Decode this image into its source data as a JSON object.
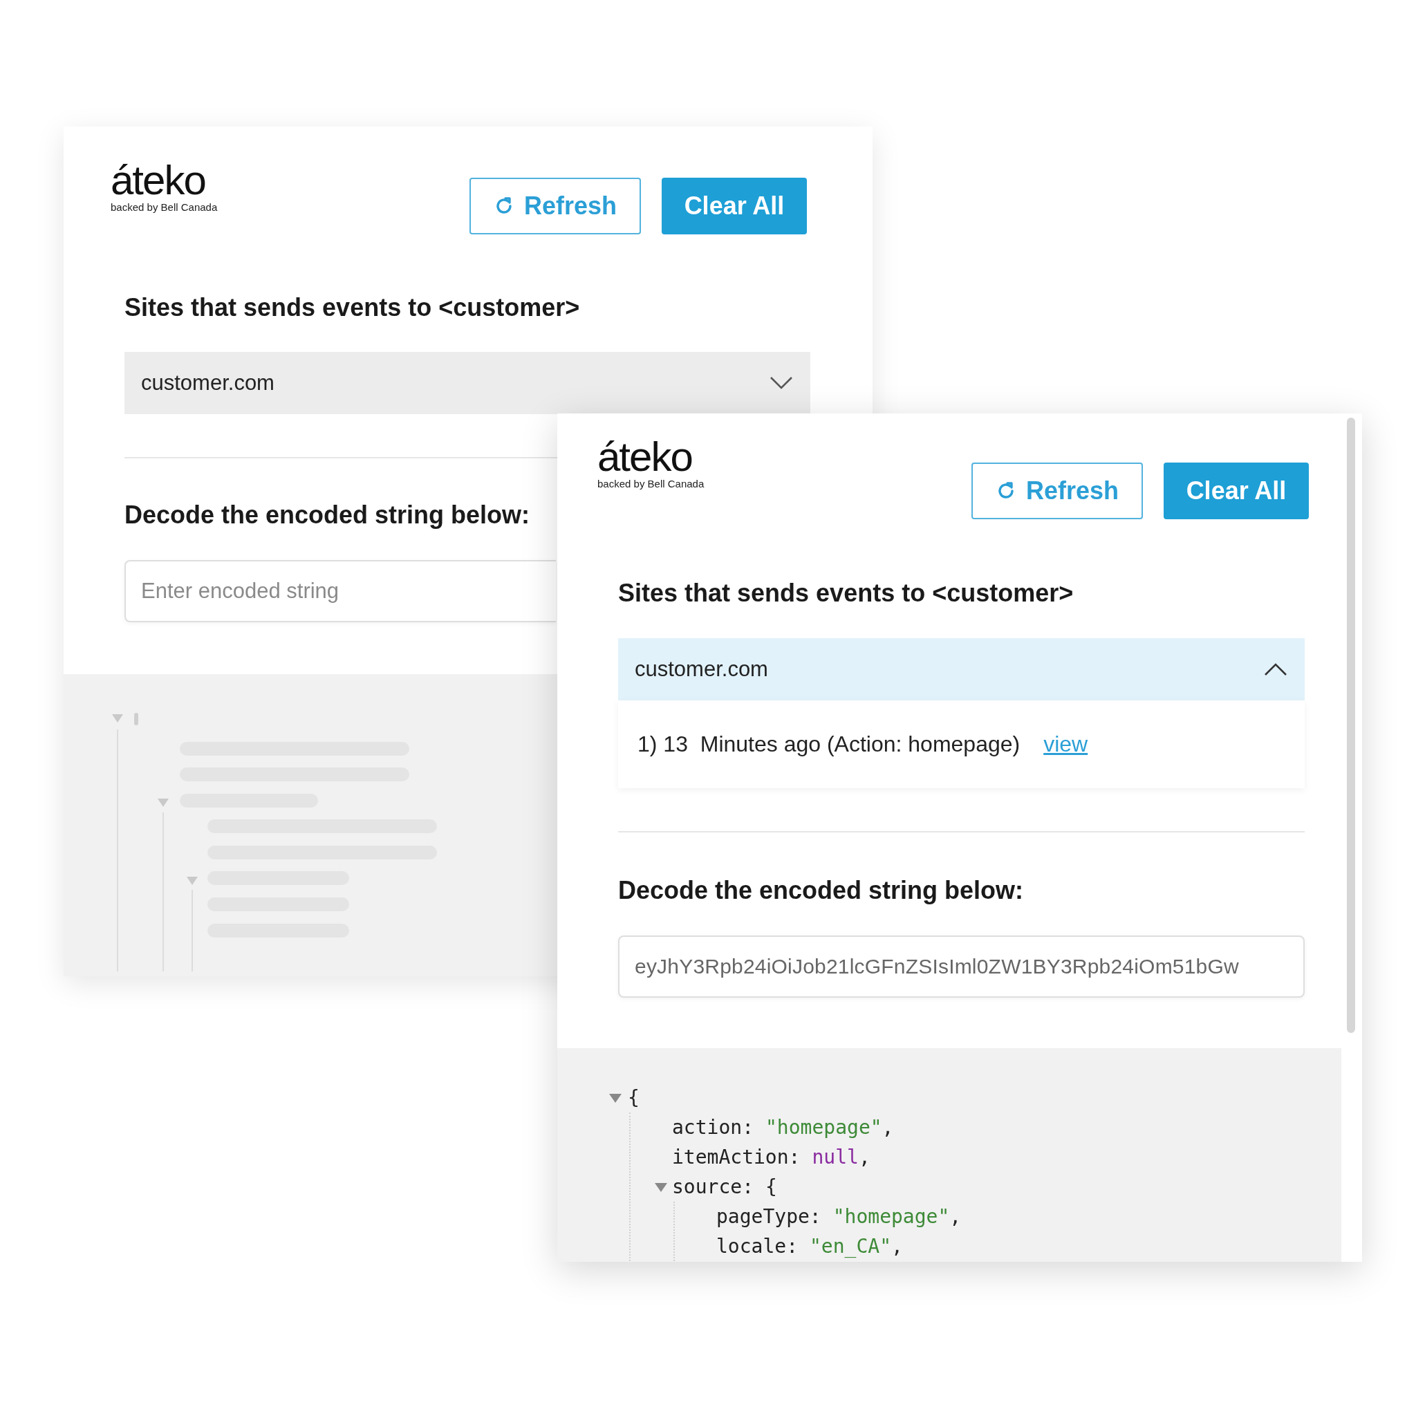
{
  "windows": [
    {
      "logo": {
        "wordmark": "áteko",
        "tagline": "backed by Bell Canada"
      },
      "buttons": [
        {
          "kind": "outline",
          "label": "Refresh"
        },
        {
          "kind": "primary",
          "label": "Clear All"
        }
      ],
      "sites_heading": "Sites that sends events to <customer>",
      "dropdown": {
        "value": "customer.com",
        "expanded": false
      },
      "decode_heading": "Decode the encoded string below:",
      "input": {
        "placeholder": "Enter encoded string"
      },
      "output": {
        "kind": "skeleton"
      }
    },
    {
      "logo": {
        "wordmark": "áteko",
        "tagline": "backed by Bell Canada"
      },
      "buttons": [
        {
          "kind": "outline",
          "label": "Refresh"
        },
        {
          "kind": "primary",
          "label": "Clear All"
        }
      ],
      "sites_heading": "Sites that sends events to <customer>",
      "dropdown": {
        "value": "customer.com",
        "expanded": true
      },
      "events": [
        {
          "text": "1) 13  Minutes ago (Action: homepage)",
          "link": "view"
        }
      ],
      "decode_heading": "Decode the encoded string below:",
      "input": {
        "value": "eyJhY3Rpb24iOiJob21lcGFnZSIsIml0ZW1BY3Rpb24iOm51bGw"
      },
      "output": {
        "kind": "tree",
        "root": {
          "value": "{",
          "expanded": true,
          "children": [
            {
              "key": "action:",
              "value": "\"homepage\"",
              "kind": "string",
              "comma": ","
            },
            {
              "key": "itemAction:",
              "value": "null",
              "kind": "null",
              "comma": ","
            },
            {
              "key": "source:",
              "value": "{",
              "kind": "object",
              "expanded": true,
              "children": [
                {
                  "key": "pageType:",
                  "value": "\"homepage\"",
                  "kind": "string",
                  "comma": ","
                },
                {
                  "key": "locale:",
                  "value": "\"en_CA\"",
                  "kind": "string",
                  "comma": ","
                }
              ]
            }
          ]
        }
      }
    }
  ]
}
